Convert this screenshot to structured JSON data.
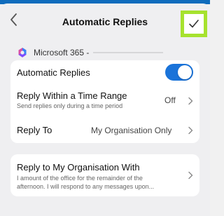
{
  "header": {
    "title": "Automatic Replies",
    "back_icon": "chevron-left-icon",
    "confirm_icon": "checkmark-icon",
    "confirm_highlight_color": "#a6e22e"
  },
  "account": {
    "name": "Microsoft 365 -",
    "icon": "microsoft-365-logo"
  },
  "settings": {
    "automatic_replies": {
      "label": "Automatic Replies",
      "enabled": true
    },
    "time_range": {
      "label": "Reply Within a Time Range",
      "sublabel": "Send replies only during a time period",
      "value": "Off"
    },
    "reply_to": {
      "label": "Reply To",
      "value": "My Organisation Only"
    }
  },
  "reply_org": {
    "label": "Reply to My Organisation With",
    "preview_line1": "I amount of the office for the remainder of the",
    "preview_line2": "afternoon. I will respond to any messages upon..."
  },
  "colors": {
    "accent": "#1a73d9",
    "top_strip": "#0f6cbd",
    "background": "#efeff1"
  }
}
